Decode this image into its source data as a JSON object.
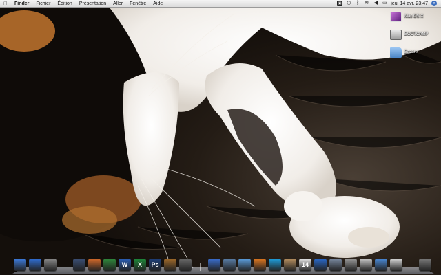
{
  "menubar": {
    "apple_icon": "apple-icon",
    "app_name": "Finder",
    "items": [
      "Fichier",
      "Édition",
      "Présentation",
      "Aller",
      "Fenêtre",
      "Aide"
    ],
    "clock": "jeu. 14 avr.  23:47",
    "tray_icons": [
      "screen-icon",
      "time-machine-icon",
      "bluetooth-icon",
      "wifi-icon",
      "volume-icon",
      "battery-icon",
      "spotlight-icon"
    ]
  },
  "desktop": {
    "icons": [
      {
        "label": "Mac OS X",
        "icon": "disk-icon"
      },
      {
        "label": "BOOTCAMP",
        "icon": "disk-icon"
      },
      {
        "label": "Bazare",
        "icon": "folder-icon"
      }
    ]
  },
  "dock": {
    "apps": [
      {
        "name": "finder",
        "icon": "finder-icon",
        "color": "#3d7de0"
      },
      {
        "name": "app-store",
        "icon": "app-store-icon",
        "color": "#2f6fd6"
      },
      {
        "name": "system-preferences",
        "icon": "gear-icon",
        "color": "#8a8a8a"
      },
      {
        "name": "script-editor",
        "icon": "pen-icon",
        "color": "#3b4f76"
      },
      {
        "name": "keynote",
        "icon": "keynote-icon",
        "color": "#d56a2a"
      },
      {
        "name": "numbers",
        "icon": "chart-icon",
        "color": "#2f8a3c"
      },
      {
        "name": "word",
        "icon": "w-icon",
        "color": "#2a5fb8"
      },
      {
        "name": "excel",
        "icon": "x-icon",
        "color": "#1e8a3a"
      },
      {
        "name": "photoshop",
        "icon": "ps-icon",
        "color": "#1d3f7a"
      },
      {
        "name": "iphoto",
        "icon": "photo-icon",
        "color": "#a06a2a"
      },
      {
        "name": "aperture",
        "icon": "aperture-icon",
        "color": "#6a6a6a"
      },
      {
        "name": "itunes",
        "icon": "music-icon",
        "color": "#3a6fd0"
      },
      {
        "name": "preview",
        "icon": "preview-icon",
        "color": "#5a7fa8"
      },
      {
        "name": "safari",
        "icon": "compass-icon",
        "color": "#5c9fe0"
      },
      {
        "name": "firefox",
        "icon": "firefox-icon",
        "color": "#e07820"
      },
      {
        "name": "skype",
        "icon": "skype-icon",
        "color": "#1ea0e0"
      },
      {
        "name": "address-book",
        "icon": "contacts-icon",
        "color": "#b89060"
      },
      {
        "name": "ical",
        "icon": "calendar-icon",
        "color": "#e8e8e8"
      },
      {
        "name": "google-earth",
        "icon": "globe-icon",
        "color": "#2a6acc"
      },
      {
        "name": "mail",
        "icon": "mail-icon",
        "color": "#7a8aa0"
      },
      {
        "name": "disk-utility",
        "icon": "disk-utility-icon",
        "color": "#9a9a9a"
      },
      {
        "name": "text-edit",
        "icon": "document-icon",
        "color": "#c8c8c8"
      },
      {
        "name": "downloads",
        "icon": "folder-icon",
        "color": "#4a8ad8"
      },
      {
        "name": "applications-stack",
        "icon": "stack-icon",
        "color": "#d8d8d8"
      },
      {
        "name": "trash",
        "icon": "trash-icon",
        "color": "#7a7a7a"
      }
    ],
    "dock_glyphs": {
      "word": "W",
      "excel": "X",
      "photoshop": "Ps",
      "ical": "14"
    }
  }
}
